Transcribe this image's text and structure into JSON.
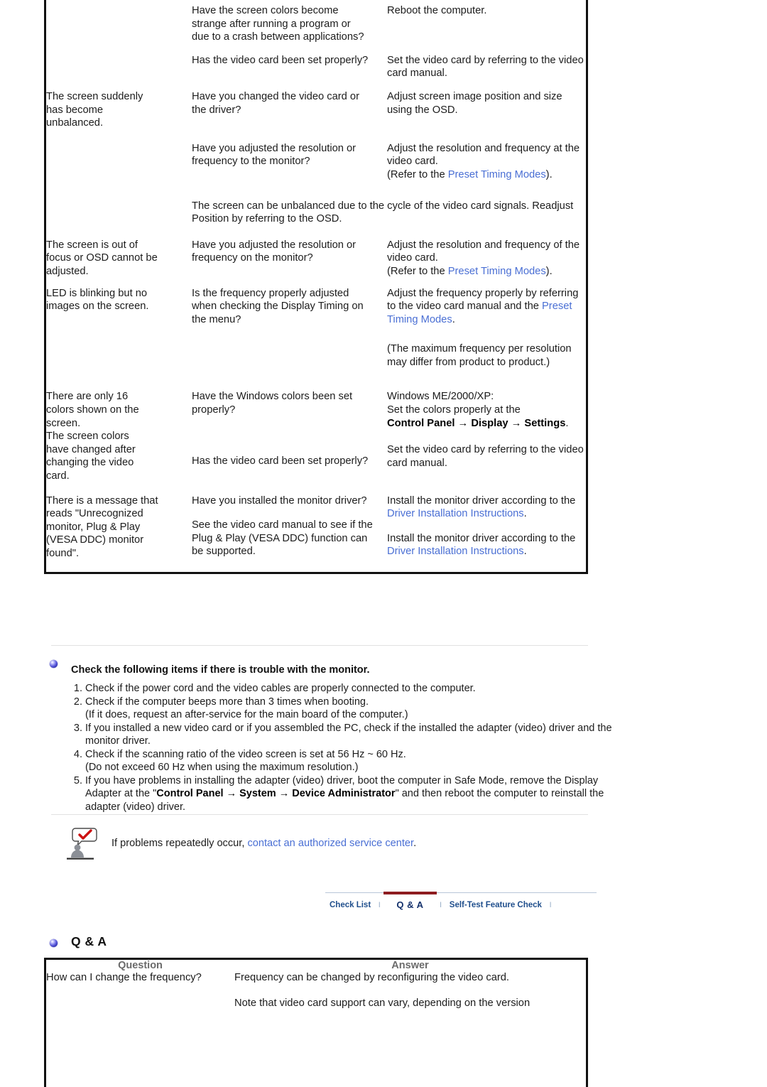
{
  "troubleshooting_table": {
    "rows": [
      {
        "symptom": "",
        "checklist": "Have the screen colors become strange after running a program or due to a crash between applications?",
        "solution_parts": [
          {
            "text": "Reboot the computer.",
            "style": "plain"
          }
        ]
      },
      {
        "symptom": "",
        "checklist": "Has the video card been set properly?",
        "solution_parts": [
          {
            "text": "Set the video card by referring to the video card manual.",
            "style": "plain"
          }
        ]
      },
      {
        "symptom": "The screen suddenly has become unbalanced.",
        "checklist": "Have you changed the video card or the driver?",
        "solution_parts": [
          {
            "text": "Adjust screen image position and size using the OSD.",
            "style": "plain"
          }
        ]
      },
      {
        "symptom": "",
        "checklist": "Have you adjusted the resolution or frequency to the monitor?",
        "solution_parts": [
          {
            "text": "Adjust the resolution and frequency at the video card.",
            "style": "plain"
          },
          {
            "text": "(Refer to the ",
            "style": "plain"
          },
          {
            "text": "Preset Timing Modes",
            "style": "link"
          },
          {
            "text": ").",
            "style": "plain"
          }
        ]
      },
      {
        "symptom": "",
        "checklist_full_width": "The screen can be unbalanced due to the cycle of the video card signals. Readjust Position by referring to the OSD.",
        "solution_parts": []
      },
      {
        "symptom": "The screen is out of focus or OSD cannot be adjusted.",
        "checklist": "Have you adjusted the resolution or frequency on the monitor?",
        "solution_parts": [
          {
            "text": "Adjust the resolution and frequency of the video card.",
            "style": "plain"
          },
          {
            "text": "(Refer to the ",
            "style": "plain"
          },
          {
            "text": "Preset Timing Modes",
            "style": "link"
          },
          {
            "text": ").",
            "style": "plain"
          }
        ]
      },
      {
        "symptom": "LED is blinking but no images on the screen.",
        "checklist": "Is the frequency properly adjusted when checking the Display Timing on the menu?",
        "solution_parts": [
          {
            "text": "Adjust the frequency properly by referring to the video card manual and the ",
            "style": "plain"
          },
          {
            "text": "Preset Timing Modes",
            "style": "link"
          },
          {
            "text": ".",
            "style": "plain"
          }
        ]
      },
      {
        "symptom": "",
        "checklist": "",
        "solution_parts": [
          {
            "text": "(The maximum frequency per resolution may differ from product to product.)",
            "style": "plain"
          }
        ]
      },
      {
        "symptom": "There are only 16 colors shown on the screen.",
        "checklist": "Have the Windows colors been set properly?",
        "solution_parts": [
          {
            "text": "Windows ME/2000/XP:",
            "style": "plain"
          },
          {
            "text": "Set the colors properly at the ",
            "style": "plain"
          },
          {
            "text": "Control Panel → Display → Settings",
            "style": "bold"
          },
          {
            "text": ".",
            "style": "plain"
          }
        ]
      },
      {
        "symptom": "The screen colors have changed after changing the video card.",
        "checklist": "Has the video card been set properly?",
        "solution_parts": [
          {
            "text": "Set the video card by referring to the video card manual.",
            "style": "plain"
          }
        ]
      },
      {
        "symptom": "There is a message that reads \"Unrecognized monitor, Plug & Play (VESA DDC) monitor found\".",
        "checklist": "Have you installed the monitor driver?",
        "solution_parts": [
          {
            "text": "Install the monitor driver according to the ",
            "style": "plain"
          },
          {
            "text": "Driver Installation Instructions",
            "style": "link"
          },
          {
            "text": ".",
            "style": "plain"
          }
        ]
      },
      {
        "symptom": "",
        "checklist": "See the video card manual to see if the Plug & Play (VESA DDC) function can be supported.",
        "solution_parts": [
          {
            "text": "Install the monitor driver according to the ",
            "style": "plain"
          },
          {
            "text": "Driver Installation Instructions",
            "style": "link"
          },
          {
            "text": ".",
            "style": "plain"
          }
        ]
      }
    ],
    "cells": {
      "r1_check": "Have the screen colors become strange after running a program or due to a crash between applications?",
      "r1_sol": "Reboot the computer.",
      "r2_check": "Has the video card been set properly?",
      "r2_sol": "Set the video card by referring to the video card manual.",
      "r3_sym": "The screen suddenly has become unbalanced.",
      "r3_check": "Have you changed the video card or the driver?",
      "r3_sol": "Adjust screen image position and size using the OSD.",
      "r4_check": "Have you adjusted the resolution or frequency to the monitor?",
      "r4_sol_a": "Adjust the resolution and frequency at the video card.",
      "r4_sol_b_pre": "(Refer to the ",
      "r4_sol_b_link": "Preset Timing Modes",
      "r4_sol_b_post": ").",
      "r5_full": "The screen can be unbalanced due to the cycle of the video card signals. Readjust Position by referring to the OSD.",
      "r6_sym": "The screen is out of focus or OSD cannot be adjusted.",
      "r6_check": "Have you adjusted the resolution or frequency on the monitor?",
      "r6_sol_a": "Adjust the resolution and frequency of the video card.",
      "r6_sol_b_pre": "(Refer to the ",
      "r6_sol_b_link": "Preset Timing Modes",
      "r6_sol_b_post": ").",
      "r7_sym": "LED is blinking but no images on the screen.",
      "r7_check": "Is the frequency properly adjusted when checking the Display Timing on the menu?",
      "r7_sol_pre": "Adjust the frequency properly by referring to the video card manual and the ",
      "r7_sol_link": "Preset Timing Modes",
      "r7_sol_post": ".",
      "r8_sol": "(The maximum frequency per resolution may differ from product to product.)",
      "r9_sym": "There are only 16 colors shown on the screen.",
      "r9_check": "Have the Windows colors been set properly?",
      "r9_sol_a": "Windows ME/2000/XP:",
      "r9_sol_b": "Set the colors properly at the",
      "r9_sol_bold": "Control Panel → Display → Settings",
      "r9_sol_period": ".",
      "r10_sym": "The screen colors have changed after changing the video card.",
      "r10_check": "Has the video card been set properly?",
      "r10_sol": "Set the video card by referring to the video card manual.",
      "r11_sym": "There is a message that reads \"Unrecognized monitor, Plug & Play (VESA DDC) monitor found\".",
      "r11_check": "Have you installed the monitor driver?",
      "r11_sol_pre": "Install the monitor driver according to the ",
      "r11_sol_link": "Driver Installation Instructions",
      "r11_sol_post": ".",
      "r12_check": "See the video card manual to see if the Plug & Play (VESA DDC) function can be supported.",
      "r12_sol_pre": "Install the monitor driver according to the ",
      "r12_sol_link": "Driver Installation Instructions",
      "r12_sol_post": "."
    }
  },
  "check_section": {
    "bullet_icon": "blue-sphere-bullet-icon",
    "heading": "Check the following items if there is trouble with the monitor.",
    "items": [
      {
        "main": "Check if the power cord and the video cables are properly connected to the computer.",
        "sub": ""
      },
      {
        "main": "Check if the computer beeps more than 3 times when booting.",
        "sub": "(If it does, request an after-service for the main board of the computer.)"
      },
      {
        "main": "If you installed a new video card or if you assembled the PC, check if the installed the adapter (video) driver and the monitor driver.",
        "sub": ""
      },
      {
        "main": "Check if the scanning ratio of the video screen is set at 56 Hz ~ 60 Hz.",
        "sub": "(Do not exceed 60 Hz when using the maximum resolution.)"
      },
      {
        "main_pre": "If you have problems in installing the adapter (video) driver, boot the computer in Safe Mode, remove the Display Adapter at the \"",
        "main_bold": "Control Panel → System → Device Administrator",
        "main_post": "\" and then reboot the computer to reinstall the adapter (video) driver."
      }
    ]
  },
  "note": {
    "icon": "person-with-checkmark-speech-bubble-icon",
    "text_pre": "If problems repeatedly occur, ",
    "link_text": "contact an authorized service center",
    "text_post": "."
  },
  "nav": {
    "tabs": [
      {
        "label": "Check List",
        "active": false
      },
      {
        "label": "Q & A",
        "active": true
      },
      {
        "label": "Self-Test Feature Check",
        "active": false
      }
    ],
    "separator": "l",
    "active_underline_color": "#8e1c20",
    "link_color": "#1f4e8c"
  },
  "qa_section": {
    "bullet_icon": "blue-sphere-bullet-icon",
    "heading": "Q & A",
    "headers": {
      "question": "Question",
      "answer": "Answer"
    },
    "rows": [
      {
        "question": "How can I change the frequency?",
        "answer_lines": [
          "Frequency can be changed by reconfiguring the video card.",
          "Note that video card support can vary, depending on the version"
        ]
      }
    ]
  },
  "colors": {
    "link_blue": "#4a6fd4",
    "nav_blue": "#1f4e8c",
    "accent_maroon": "#8e1c20",
    "table_border": "#111111",
    "rule_gray": "#e2e2e2",
    "header_gray": "#6b6b6b"
  }
}
